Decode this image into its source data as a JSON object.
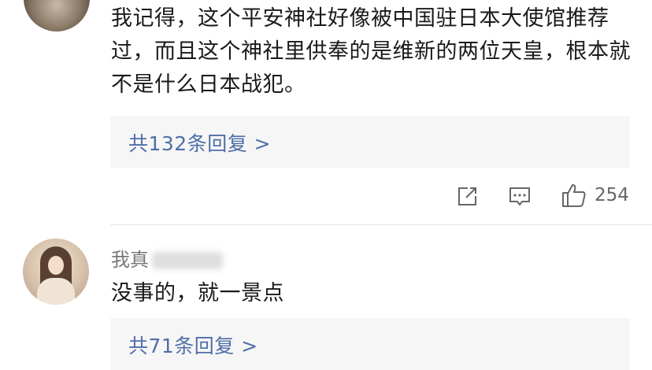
{
  "comments": [
    {
      "text": "我记得，这个平安神社好像被中国驻日本大使馆推荐过，而且这个神社里供奉的是维新的两位天皇，根本就不是什么日本战犯。",
      "reply_link": "共132条回复 >",
      "like_count": "254"
    },
    {
      "username": "我真",
      "text": "没事的，就一景点",
      "reply_link": "共71条回复 >"
    }
  ],
  "icons": {
    "share": "share-icon",
    "comment": "comment-icon",
    "like": "thumbs-up-icon"
  },
  "colors": {
    "link": "#4f6ea8",
    "text": "#1a1a1a",
    "muted": "#666666",
    "reply_bg": "#f6f6f6"
  }
}
